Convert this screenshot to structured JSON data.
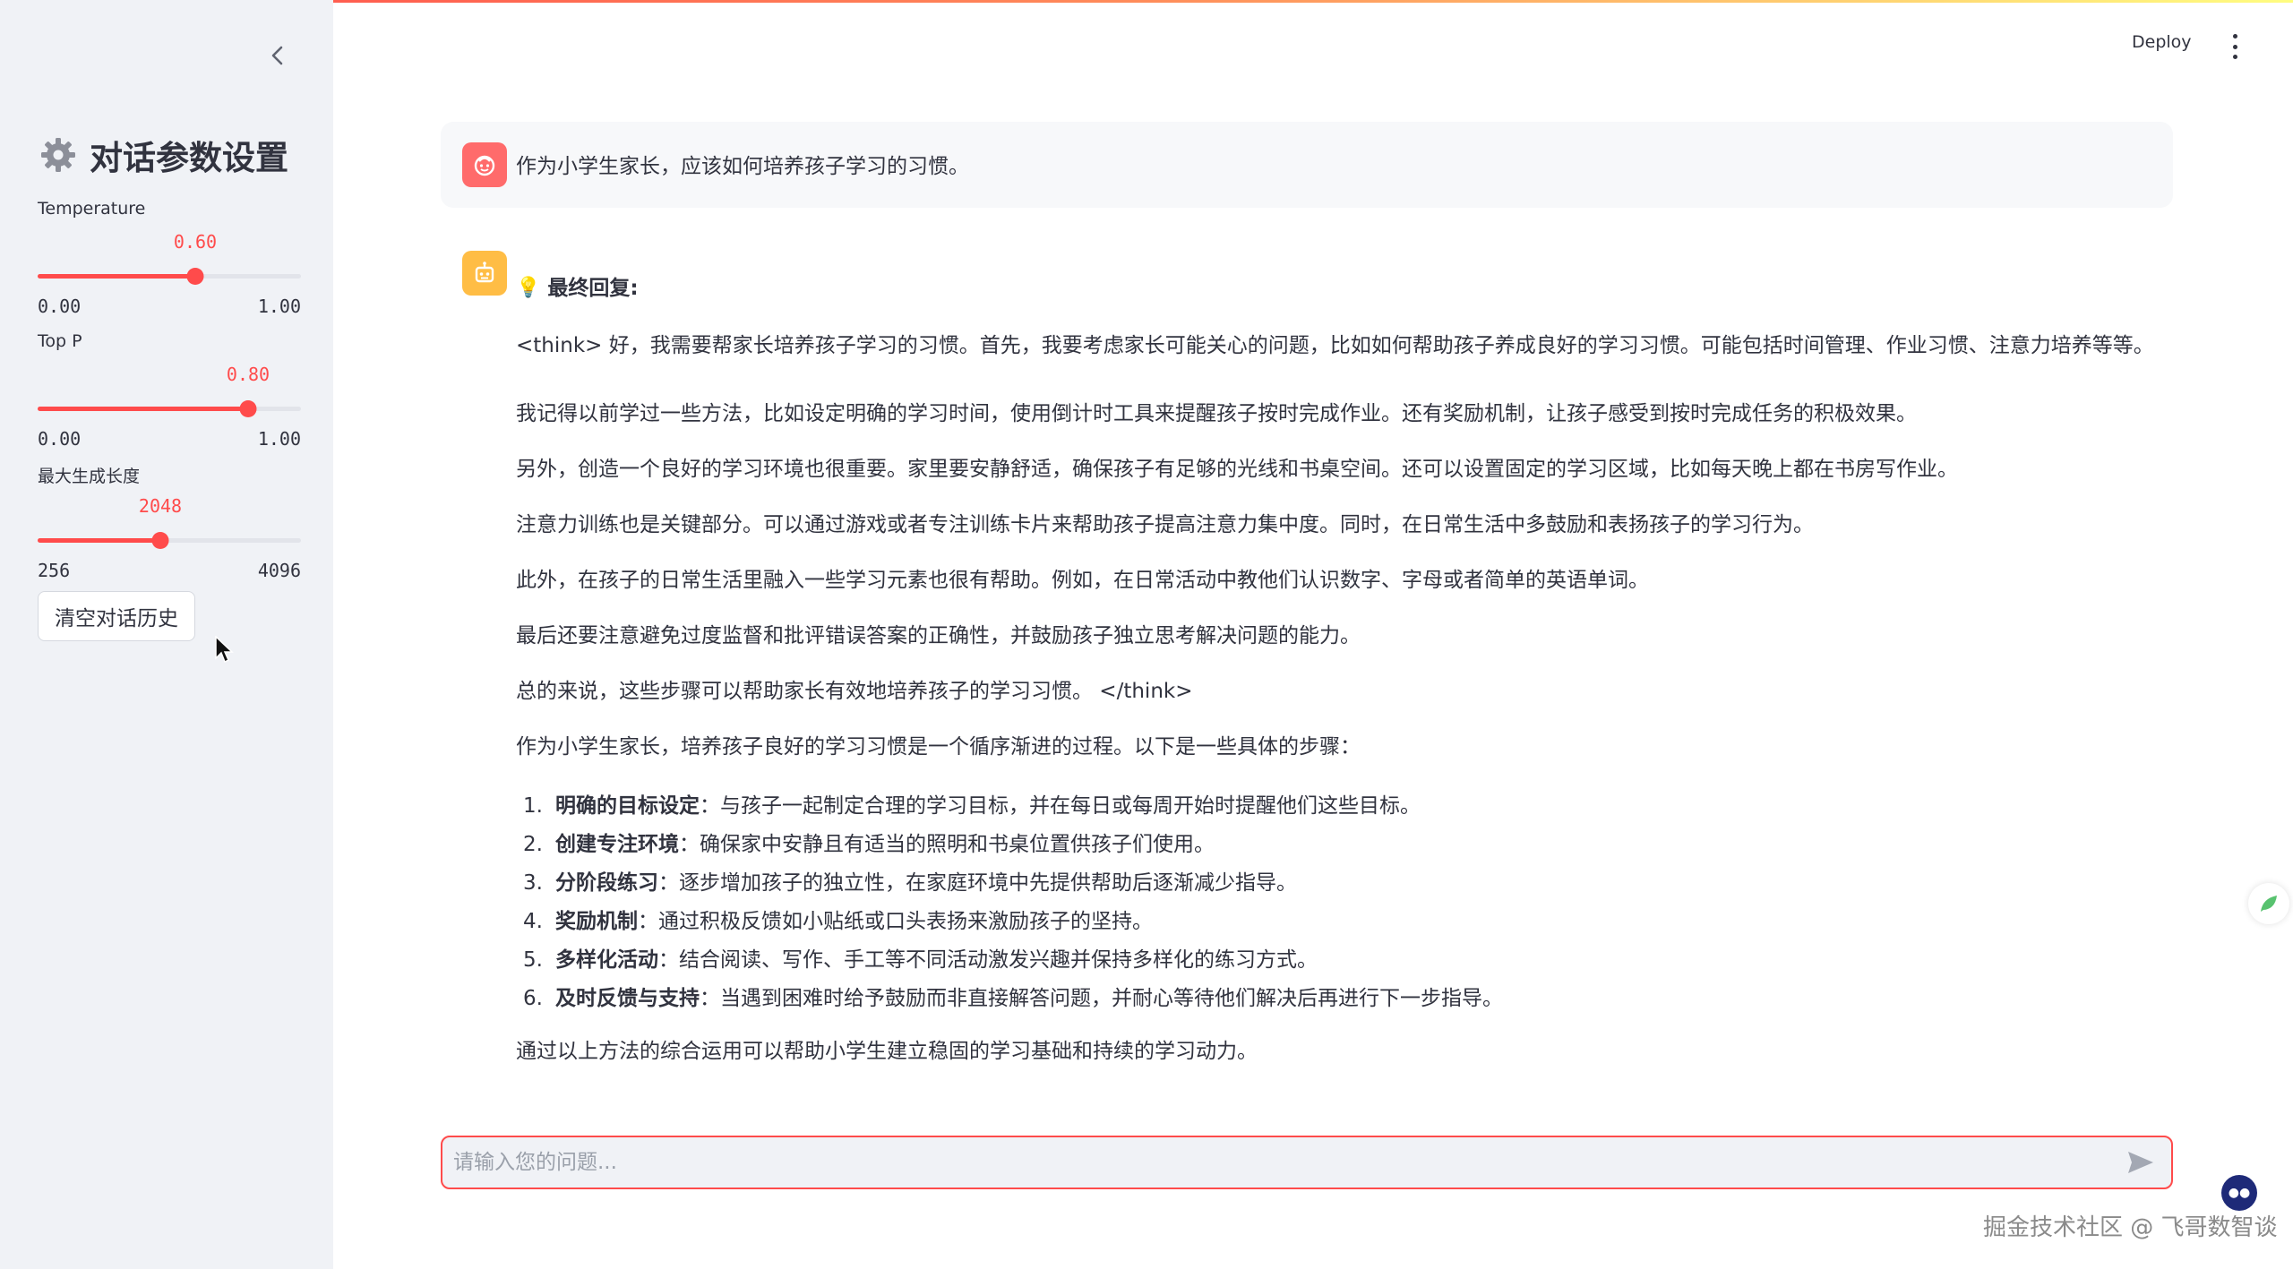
{
  "sidebar": {
    "title": "对话参数设置",
    "sliders": [
      {
        "label": "Temperature",
        "value": "0.60",
        "min": "0.00",
        "max": "1.00",
        "fraction": 0.6
      },
      {
        "label": "Top P",
        "value": "0.80",
        "min": "0.00",
        "max": "1.00",
        "fraction": 0.8
      },
      {
        "label": "最大生成长度",
        "value": "2048",
        "min": "256",
        "max": "4096",
        "fraction": 0.4667
      }
    ],
    "clear_button": "清空对话历史"
  },
  "header": {
    "deploy_label": "Deploy"
  },
  "chat": {
    "user_message": "作为小学生家长，应该如何培养孩子学习的习惯。",
    "assistant": {
      "final_title": "最终回复:",
      "paragraphs": [
        "<think> 好，我需要帮家长培养孩子学习的习惯。首先，我要考虑家长可能关心的问题，比如如何帮助孩子养成良好的学习习惯。可能包括时间管理、作业习惯、注意力培养等等。",
        "我记得以前学过一些方法，比如设定明确的学习时间，使用倒计时工具来提醒孩子按时完成作业。还有奖励机制，让孩子感受到按时完成任务的积极效果。",
        "另外，创造一个良好的学习环境也很重要。家里要安静舒适，确保孩子有足够的光线和书桌空间。还可以设置固定的学习区域，比如每天晚上都在书房写作业。",
        "注意力训练也是关键部分。可以通过游戏或者专注训练卡片来帮助孩子提高注意力集中度。同时，在日常生活中多鼓励和表扬孩子的学习行为。",
        "此外，在孩子的日常生活里融入一些学习元素也很有帮助。例如，在日常活动中教他们认识数字、字母或者简单的英语单词。",
        "最后还要注意避免过度监督和批评错误答案的正确性，并鼓励孩子独立思考解决问题的能力。",
        "总的来说，这些步骤可以帮助家长有效地培养孩子的学习习惯。 </think>",
        "作为小学生家长，培养孩子良好的学习习惯是一个循序渐进的过程。以下是一些具体的步骤："
      ],
      "steps": [
        {
          "num": "1.",
          "title": "明确的目标设定",
          "text": "：与孩子一起制定合理的学习目标，并在每日或每周开始时提醒他们这些目标。"
        },
        {
          "num": "2.",
          "title": "创建专注环境",
          "text": "：确保家中安静且有适当的照明和书桌位置供孩子们使用。"
        },
        {
          "num": "3.",
          "title": "分阶段练习",
          "text": "：逐步增加孩子的独立性，在家庭环境中先提供帮助后逐渐减少指导。"
        },
        {
          "num": "4.",
          "title": "奖励机制",
          "text": "：通过积极反馈如小贴纸或口头表扬来激励孩子的坚持。"
        },
        {
          "num": "5.",
          "title": "多样化活动",
          "text": "：结合阅读、写作、手工等不同活动激发兴趣并保持多样化的练习方式。"
        },
        {
          "num": "6.",
          "title": "及时反馈与支持",
          "text": "：当遇到困难时给予鼓励而非直接解答问题，并耐心等待他们解决后再进行下一步指导。"
        }
      ],
      "closing": "通过以上方法的综合运用可以帮助小学生建立稳固的学习基础和持续的学习动力。"
    },
    "input_placeholder": "请输入您的问题..."
  },
  "watermark": "掘金技术社区 @ 飞哥数智谈",
  "colors": {
    "accent": "#ff4b4b",
    "sidebar_bg": "#f0f2f6",
    "user_avatar": "#ff6b6b",
    "bot_avatar": "#ffbd45"
  }
}
